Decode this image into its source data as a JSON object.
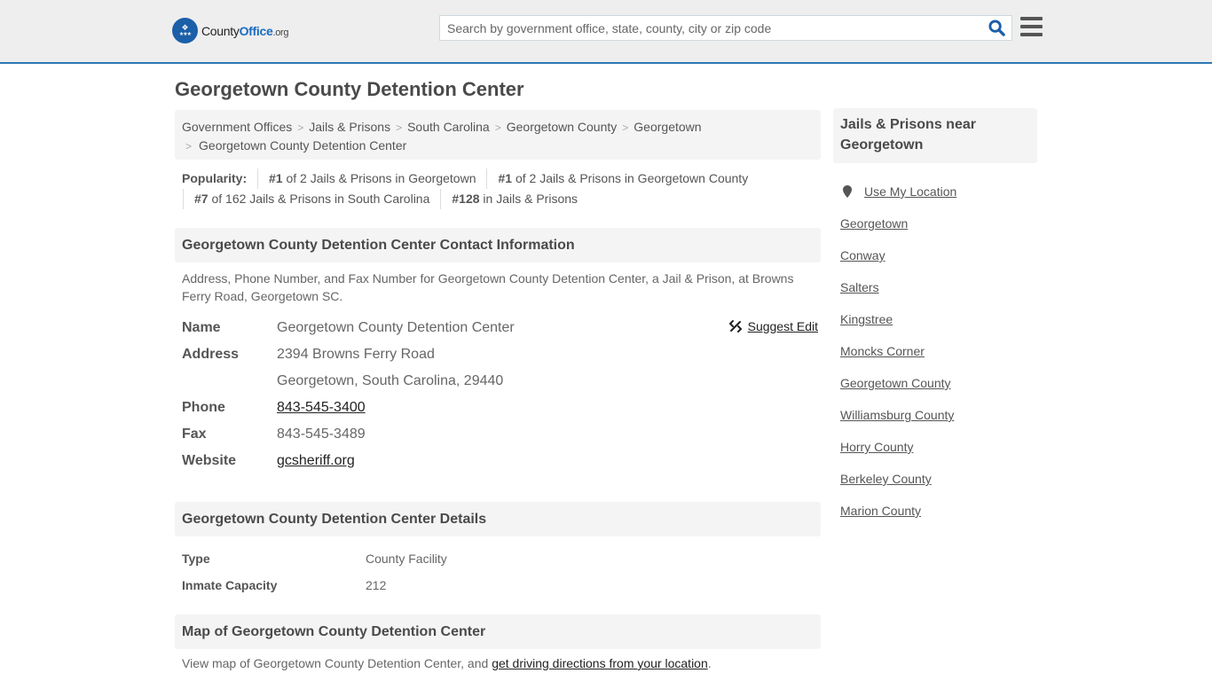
{
  "header": {
    "logo": {
      "county": "County",
      "office": "Office",
      "org": ".org"
    },
    "search": {
      "placeholder": "Search by government office, state, county, city or zip code",
      "value": ""
    },
    "accent_color": "#2d78b4"
  },
  "page_title": "Georgetown County Detention Center",
  "breadcrumb": {
    "items": [
      "Government Offices",
      "Jails & Prisons",
      "South Carolina",
      "Georgetown County",
      "Georgetown"
    ],
    "current": "Georgetown County Detention Center",
    "separator": ">"
  },
  "popularity": {
    "label": "Popularity:",
    "items": [
      {
        "rank": "#1",
        "text": " of 2 Jails & Prisons in Georgetown"
      },
      {
        "rank": "#1",
        "text": " of 2 Jails & Prisons in Georgetown County"
      },
      {
        "rank": "#7",
        "text": " of 162 Jails & Prisons in South Carolina"
      },
      {
        "rank": "#128",
        "text": " in Jails & Prisons"
      }
    ]
  },
  "contact": {
    "heading": "Georgetown County Detention Center Contact Information",
    "intro": "Address, Phone Number, and Fax Number for Georgetown County Detention Center, a Jail & Prison, at Browns Ferry Road, Georgetown SC.",
    "suggest_edit": "Suggest Edit",
    "labels": {
      "name": "Name",
      "address": "Address",
      "phone": "Phone",
      "fax": "Fax",
      "website": "Website"
    },
    "name": "Georgetown County Detention Center",
    "address_line1": "2394 Browns Ferry Road",
    "address_line2": "Georgetown, South Carolina, 29440",
    "phone": "843-545-3400",
    "fax": "843-545-3489",
    "website": "gcsheriff.org"
  },
  "details": {
    "heading": "Georgetown County Detention Center Details",
    "rows": [
      {
        "label": "Type",
        "value": "County Facility"
      },
      {
        "label": "Inmate Capacity",
        "value": "212"
      }
    ]
  },
  "map": {
    "heading": "Map of Georgetown County Detention Center",
    "text": "View map of Georgetown County Detention Center, and ",
    "link": "get driving directions from your location",
    "end": "."
  },
  "sidebar": {
    "heading": "Jails & Prisons near Georgetown",
    "use_location": "Use My Location",
    "links": [
      "Georgetown",
      "Conway",
      "Salters",
      "Kingstree",
      "Moncks Corner",
      "Georgetown County",
      "Williamsburg County",
      "Horry County",
      "Berkeley County",
      "Marion County"
    ]
  }
}
